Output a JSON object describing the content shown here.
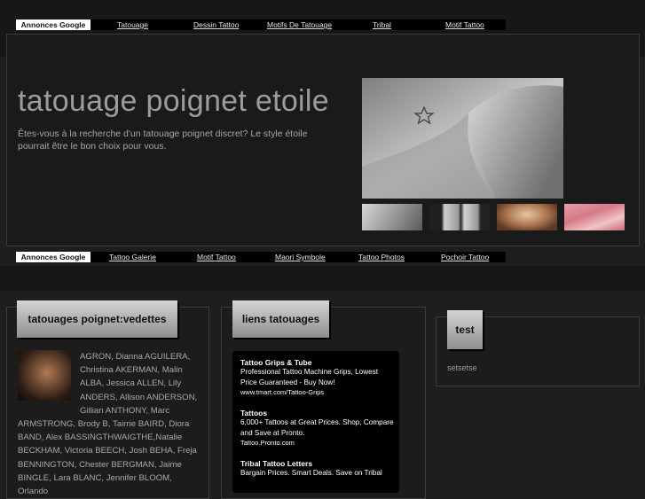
{
  "adbar_top": {
    "label": "Annonces Google",
    "links": [
      "Tatouage",
      "Dessin Tattoo",
      "Motifs De Tatouage",
      "Tribal",
      "Motif Tattoo"
    ]
  },
  "hero": {
    "title": "tatouage poignet etoile",
    "description": "Êtes-vous à la recherche d'un tatouage poignet discret? Le  style étoile pourrait être le bon choix pour vous."
  },
  "adbar_mid": {
    "label": "Annonces Google",
    "links": [
      "Tattoo Galerie",
      "Motif Tattoo",
      "Maori Symbole",
      "Tattoo Photos",
      "Pochoir Tattoo"
    ]
  },
  "vedettes": {
    "title": "tatouages poignet:vedettes",
    "text": "AGRON, Dianna AGUILERA, Christina AKERMAN, Malin ALBA, Jessica ALLEN, Lily ANDERS, Allison ANDERSON, Gillian ANTHONY, Marc ARMSTRONG, Brody B, Tairrie BAIRD, Diora BAND, Alex BASSINGTHWAIGTHE,Natalie BECKHAM, Victoria BEECH, Josh BEHA, Freja BENNINGTON, Chester BERGMAN, Jaime BINGLE, Lara BLANC, Jennifer BLOOM, Orlando"
  },
  "liens": {
    "title": "liens tatouages",
    "ads": [
      {
        "title": "Tattoo Grips & Tube",
        "text": "Professional Tattoo Machine Grips, Lowest Price Guaranteed - Buy Now!",
        "url": "www.tmart.com/Tattoo-Grips"
      },
      {
        "title": "Tattoos",
        "text": "6,000+ Tattoos at Great Prices. Shop, Compare and Save at Pronto.",
        "url": "Tattoo.Pronto.com"
      },
      {
        "title": "Tribal Tattoo Letters",
        "text": "Bargain Prices. Smart Deals. Save on Tribal",
        "url": ""
      }
    ]
  },
  "test": {
    "title": "test",
    "text": "setsetse"
  }
}
